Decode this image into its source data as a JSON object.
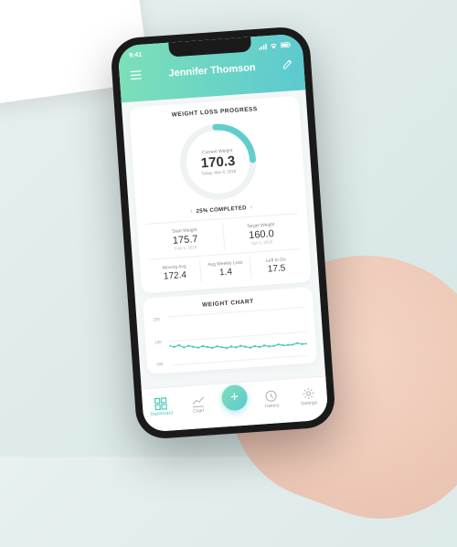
{
  "status": {
    "time": "9:41"
  },
  "header": {
    "user_name": "Jennifer Thomson"
  },
  "progress_card": {
    "title": "WEIGHT LOSS PROGRESS",
    "gauge": {
      "label": "Current Weight",
      "value": "170.3",
      "date": "Today, Mar 8, 2018",
      "percent": 25
    },
    "completed": "25% COMPLETED",
    "start": {
      "label": "Start Weight",
      "value": "175.7",
      "date": "Feb 1, 2018"
    },
    "target": {
      "label": "Target Weight",
      "value": "160.0",
      "date": "Apr 1, 2018"
    },
    "stats": {
      "moving_avg": {
        "label": "Moving Avg",
        "value": "172.4"
      },
      "weekly": {
        "label": "Avg Weekly Loss",
        "value": "1.4"
      },
      "left": {
        "label": "Left to Go",
        "value": "17.5"
      }
    }
  },
  "chart_card": {
    "title": "WEIGHT CHART"
  },
  "chart_data": {
    "type": "line",
    "ylim": [
      160,
      200
    ],
    "yticks": [
      200,
      180,
      160
    ],
    "x": [
      0,
      1,
      2,
      3,
      4,
      5,
      6,
      7,
      8,
      9,
      10,
      11,
      12,
      13,
      14,
      15,
      16,
      17,
      18,
      19,
      20,
      21,
      22,
      23,
      24,
      25,
      26,
      27,
      28,
      29
    ],
    "values": [
      176,
      175,
      176,
      174,
      175,
      174,
      173,
      174,
      173,
      172,
      173,
      172,
      171,
      172,
      171,
      172,
      171,
      170,
      171,
      170,
      171,
      170,
      170,
      171,
      170,
      170,
      170,
      171,
      170,
      170
    ],
    "color": "#47c9b8"
  },
  "nav": {
    "dashboard": "Dashboard",
    "chart": "Chart",
    "history": "History",
    "settings": "Settings"
  }
}
